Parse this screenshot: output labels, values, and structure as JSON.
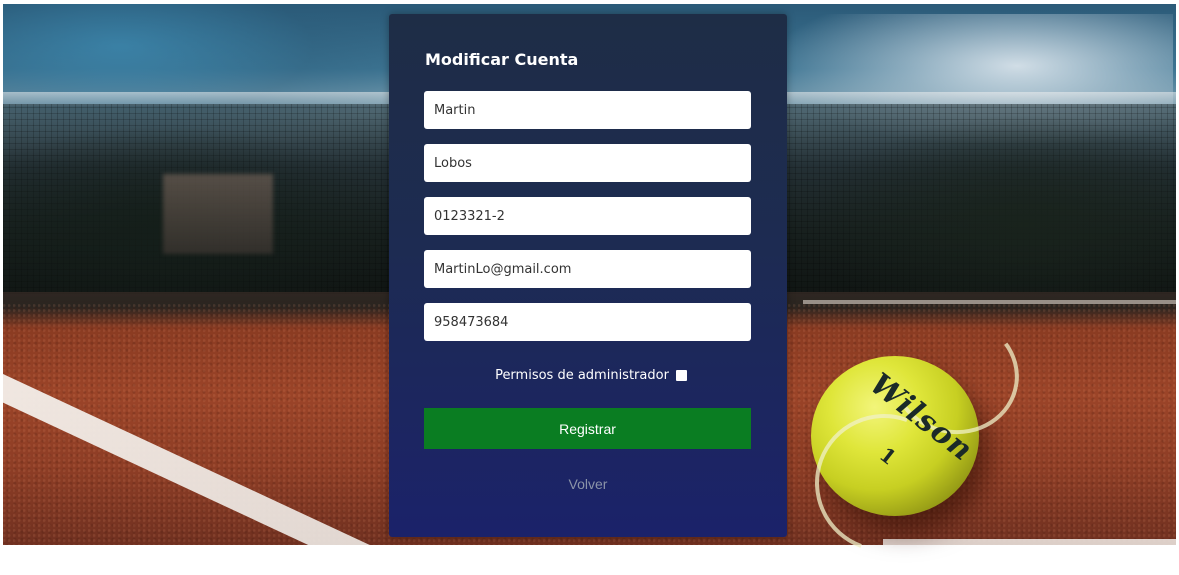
{
  "form": {
    "title": "Modificar Cuenta",
    "fields": [
      {
        "value": "Martin"
      },
      {
        "value": "Lobos"
      },
      {
        "value": "0123321-2"
      },
      {
        "value": "MartinLo@gmail.com"
      },
      {
        "value": "958473684"
      }
    ],
    "admin_label": "Permisos de administrador",
    "admin_checked": false,
    "submit_label": "Registrar",
    "back_label": "Volver"
  },
  "background": {
    "ball_brand": "Wilson",
    "ball_number": "1"
  },
  "colors": {
    "card_top": "#1e2d46",
    "card_bottom": "#1b226a",
    "submit_button": "#0a7d22",
    "back_link": "#8b94a8",
    "ball": "#dfe63a",
    "court": "#9b4428"
  }
}
